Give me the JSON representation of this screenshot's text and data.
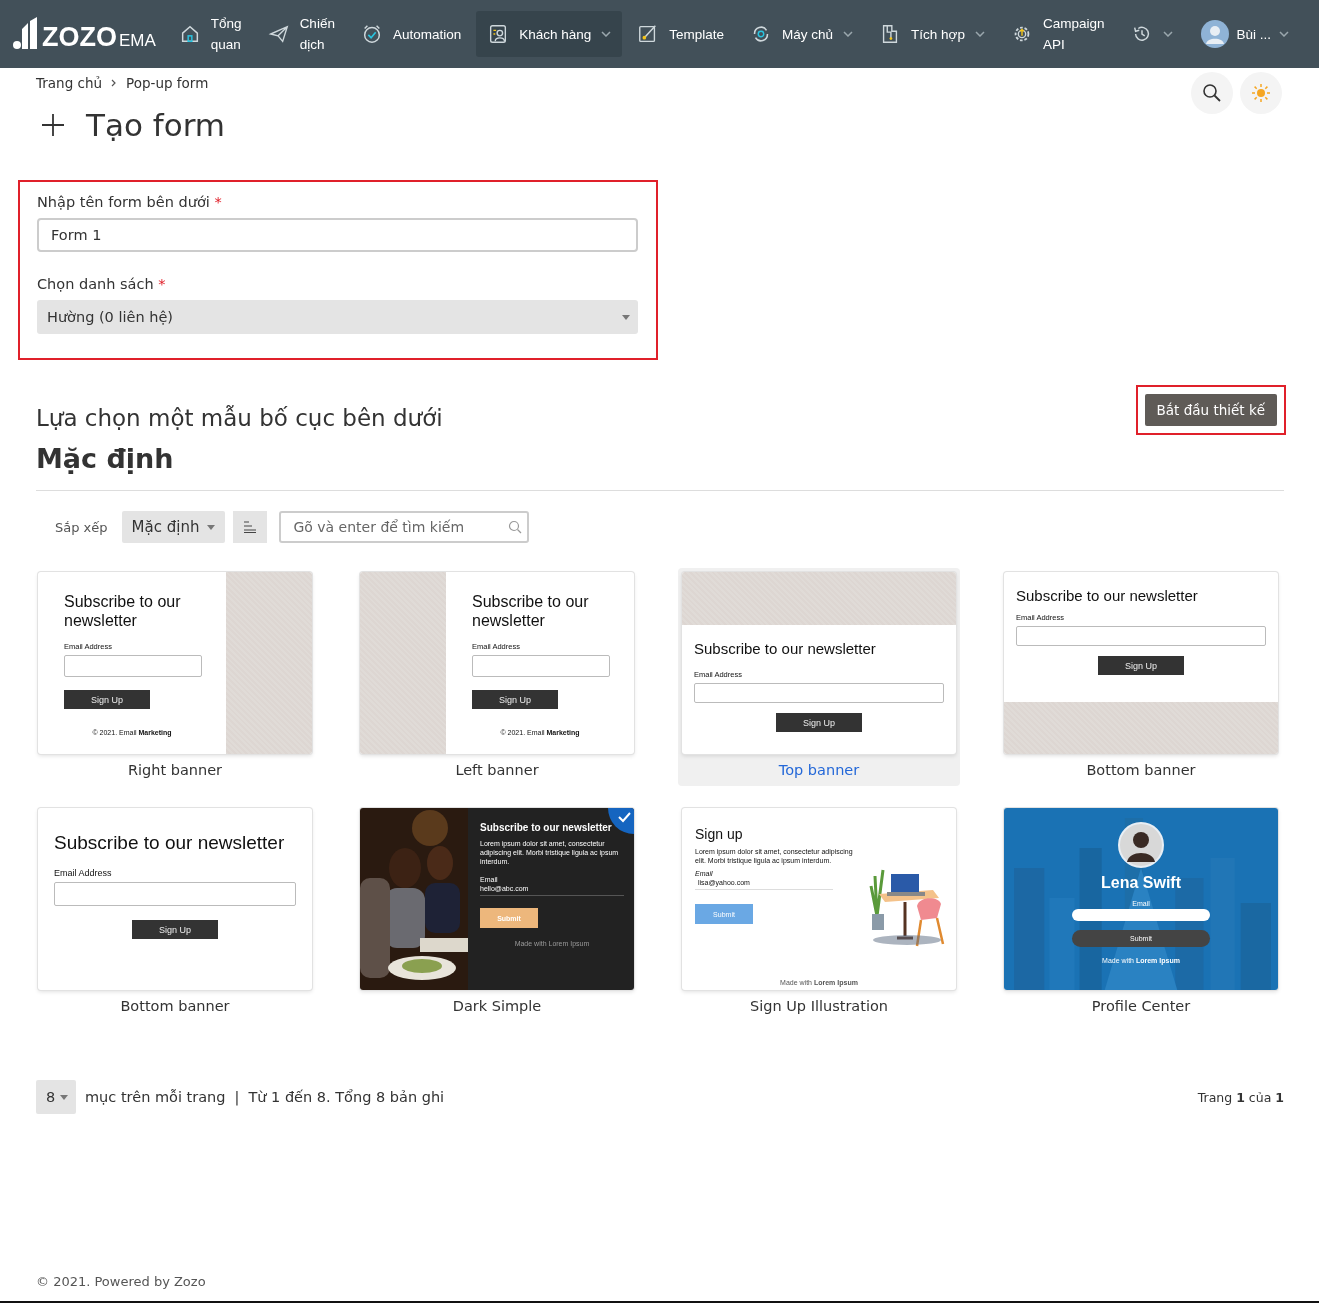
{
  "nav": {
    "logo": "ZOZO",
    "logo_suffix": "EMA",
    "items": [
      {
        "label": "Tổng\nquan",
        "caret": false,
        "selected": false
      },
      {
        "label": "Chiến\ndịch",
        "caret": false,
        "selected": false
      },
      {
        "label": "Automation",
        "caret": false,
        "selected": false
      },
      {
        "label": "Khách hàng",
        "caret": true,
        "selected": true
      },
      {
        "label": "Template",
        "caret": false,
        "selected": false
      },
      {
        "label": "Máy chủ",
        "caret": true,
        "selected": false
      },
      {
        "label": "Tích hợp",
        "caret": true,
        "selected": false
      },
      {
        "label": "Campaign\nAPI",
        "caret": false,
        "selected": false
      }
    ],
    "user": "Bùi ..."
  },
  "breadcrumb": [
    "Trang chủ",
    "Pop-up form"
  ],
  "page_title": "Tạo form",
  "form": {
    "name_label": "Nhập tên form bên dưới",
    "name_mark": "*",
    "name_value": "Form 1",
    "list_label": "Chọn danh sách",
    "list_mark": "*",
    "list_value": "Hường (0 liên hệ)"
  },
  "section_title": "Lựa chọn một mẫu bố cục bên dưới",
  "start_button": "Bắt đầu thiết kế",
  "group_title": "Mặc định",
  "toolbar": {
    "sort_label": "Sắp xếp",
    "sort_value": "Mặc định",
    "search_placeholder": "Gõ và enter để tìm kiếm"
  },
  "templates": [
    {
      "kind": "right",
      "label": "Right banner",
      "selected": false,
      "checked": false,
      "title": "Subscribe to our newsletter",
      "field_label": "Email Address",
      "button": "Sign Up",
      "footer": "© 2021. Email **Marketing**"
    },
    {
      "kind": "left",
      "label": "Left banner",
      "selected": false,
      "checked": false,
      "title": "Subscribe to our newsletter",
      "field_label": "Email Address",
      "button": "Sign Up",
      "footer": "© 2021. Email **Marketing**"
    },
    {
      "kind": "top",
      "label": "Top banner",
      "selected": true,
      "checked": false,
      "title": "Subscribe to our newsletter",
      "field_label": "Email Address",
      "button": "Sign Up"
    },
    {
      "kind": "bottom",
      "label": "Bottom banner",
      "selected": false,
      "checked": false,
      "title": "Subscribe to our newsletter",
      "field_label": "Email Address",
      "button": "Sign Up"
    },
    {
      "kind": "plain",
      "label": "Bottom banner",
      "selected": false,
      "checked": false,
      "title": "Subscribe to our newsletter",
      "field_label": "Email Address",
      "button": "Sign Up"
    },
    {
      "kind": "dark",
      "label": "Dark Simple",
      "selected": false,
      "checked": true,
      "title": "Subscribe to our newsletter",
      "text": "Lorem ipsum dolor sit amet, consectetur adipiscing elit. Morbi tristique ligula ac ipsum interdum.",
      "field_label": "Email",
      "value": "hello@abc.com",
      "button": "Submit",
      "footer": "Made with Lorem Ipsum"
    },
    {
      "kind": "signup",
      "label": "Sign Up Illustration",
      "selected": false,
      "checked": false,
      "title": "Sign up",
      "text": "Lorem ipsum dolor sit amet, consectetur adipiscing elit. Morbi tristique ligula ac ipsum interdum.",
      "field_label": "Email",
      "value": "lisa@yahoo.com",
      "button": "Submit",
      "footer": "Made with **Lorem Ipsum**"
    },
    {
      "kind": "profile",
      "label": "Profile Center",
      "selected": false,
      "checked": false,
      "title": "Lena Swift",
      "field_label": "Email",
      "button": "Submit",
      "footer": "Made with **Lorem Ipsum**"
    }
  ],
  "pagination": {
    "per_page": "8",
    "per_page_label": "mục trên mỗi trang",
    "separator": "|",
    "range": "Từ 1 đến 8. Tổng 8 bản ghi",
    "page": "Trang **1** của **1**"
  },
  "footer": "© 2021. Powered by Zozo"
}
